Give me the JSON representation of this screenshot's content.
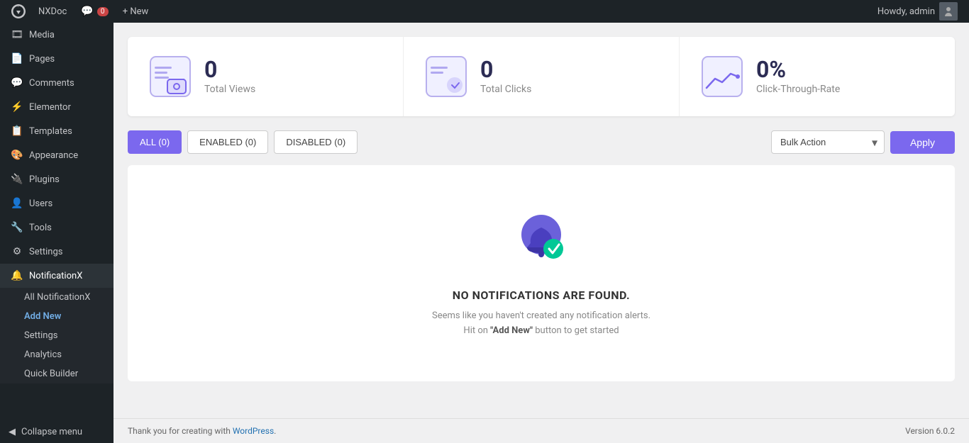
{
  "adminbar": {
    "logo_label": "WordPress",
    "site_name": "NXDoc",
    "comments_icon": "💬",
    "comments_count": "0",
    "new_label": "+ New",
    "howdy": "Howdy, admin"
  },
  "sidebar": {
    "items": [
      {
        "id": "media",
        "label": "Media",
        "icon": "🎞"
      },
      {
        "id": "pages",
        "label": "Pages",
        "icon": "📄"
      },
      {
        "id": "comments",
        "label": "Comments",
        "icon": "💬"
      },
      {
        "id": "elementor",
        "label": "Elementor",
        "icon": "⚡"
      },
      {
        "id": "templates",
        "label": "Templates",
        "icon": "📋"
      },
      {
        "id": "appearance",
        "label": "Appearance",
        "icon": "🎨"
      },
      {
        "id": "plugins",
        "label": "Plugins",
        "icon": "🔌"
      },
      {
        "id": "users",
        "label": "Users",
        "icon": "👤"
      },
      {
        "id": "tools",
        "label": "Tools",
        "icon": "🔧"
      },
      {
        "id": "settings",
        "label": "Settings",
        "icon": "⚙"
      },
      {
        "id": "notificationx",
        "label": "NotificationX",
        "icon": "🔔"
      }
    ],
    "submenu": [
      {
        "id": "all-notificationx",
        "label": "All NotificationX"
      },
      {
        "id": "add-new",
        "label": "Add New"
      },
      {
        "id": "settings-sub",
        "label": "Settings"
      },
      {
        "id": "analytics",
        "label": "Analytics"
      },
      {
        "id": "quick-builder",
        "label": "Quick Builder"
      }
    ],
    "collapse_label": "Collapse menu"
  },
  "stats": [
    {
      "id": "total-views",
      "number": "0",
      "label": "Total Views"
    },
    {
      "id": "total-clicks",
      "number": "0",
      "label": "Total Clicks"
    },
    {
      "id": "ctr",
      "number": "0%",
      "label": "Click-Through-Rate"
    }
  ],
  "filters": {
    "tabs": [
      {
        "id": "all",
        "label": "ALL (0)",
        "active": true
      },
      {
        "id": "enabled",
        "label": "ENABLED (0)",
        "active": false
      },
      {
        "id": "disabled",
        "label": "DISABLED (0)",
        "active": false
      }
    ],
    "bulk_action_placeholder": "Bulk Action",
    "apply_label": "Apply"
  },
  "empty_state": {
    "title": "NO NOTIFICATIONS ARE FOUND.",
    "desc1": "Seems like you haven't created any notification alerts.",
    "desc2_before": "Hit on ",
    "desc2_link": "\"Add New\"",
    "desc2_after": " button to get started"
  },
  "footer": {
    "thank_you": "Thank you for creating with ",
    "wordpress": "WordPress",
    "version": "Version 6.0.2"
  }
}
